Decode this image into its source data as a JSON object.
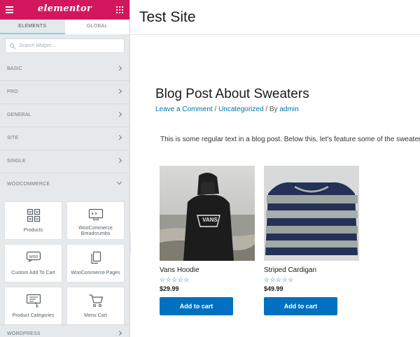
{
  "panel": {
    "brand": "elementor",
    "tabs": [
      "ELEMENTS",
      "GLOBAL"
    ],
    "search_placeholder": "Search Widget...",
    "categories": [
      "BASIC",
      "PRO",
      "GENERAL",
      "SITE",
      "SINGLE",
      "WOOCOMMERCE"
    ],
    "widgets": [
      {
        "label": "Products",
        "icon": "products-icon"
      },
      {
        "label": "WooCommerce Breadcrumbs",
        "icon": "breadcrumbs-icon"
      },
      {
        "label": "Custom Add To Cart",
        "icon": "woo-icon"
      },
      {
        "label": "WooCommerce Pages",
        "icon": "pages-icon"
      },
      {
        "label": "Product Categories",
        "icon": "categories-icon"
      },
      {
        "label": "Menu Cart",
        "icon": "cart-icon"
      }
    ],
    "last_category": "WORDPRESS",
    "accent_color": "#d3175f"
  },
  "site": {
    "title": "Test Site",
    "post_title": "Blog Post About Sweaters",
    "meta": {
      "comment_link": "Leave a Comment",
      "sep1": " / ",
      "category": "Uncategorized",
      "sep2": " / By ",
      "author": "admin"
    },
    "body_text": "This is some regular text in a blog post. Below this, let's feature some of the sweaters",
    "products": [
      {
        "name": "Vans Hoodie",
        "stars": "☆☆☆☆☆",
        "price": "$29.99",
        "button": "Add to cart",
        "hoodie_text": "VANS"
      },
      {
        "name": "Striped Cardigan",
        "stars": "☆☆☆☆☆",
        "price": "$49.99",
        "button": "Add to cart"
      }
    ],
    "button_color": "#0071c1",
    "link_color": "#0073aa"
  }
}
